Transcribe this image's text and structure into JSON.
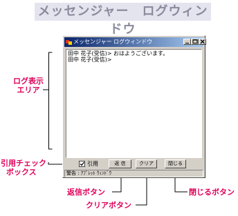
{
  "page_title": "メッセンジャー　ログウィンドウ",
  "window": {
    "title": "メッセンジャー ログウィンドウ",
    "minimize_label": "_",
    "log_lines": [
      "田中 花子(受信)> おはようございます。",
      "田中 花子(受信)>"
    ],
    "quote_checkbox_label": "引用",
    "quote_checked": true,
    "reply_button": "返 信",
    "clear_button": "クリア",
    "close_button": "閉じる",
    "status_text": "警告 : ｱﾌﾟﾚｯﾄ ｳｨﾝﾄﾞｳ"
  },
  "annotations": {
    "log_area": [
      "ログ表示",
      "エリア"
    ],
    "quote_check": [
      "引用チェック",
      "ボックス"
    ],
    "reply": "返信ボタン",
    "clear": "クリアボタン",
    "close": "閉じるボタン"
  },
  "colors": {
    "annotation": "#e0005a",
    "title_bg": "#e4e4ef",
    "title_text": "#8a8a9c"
  }
}
